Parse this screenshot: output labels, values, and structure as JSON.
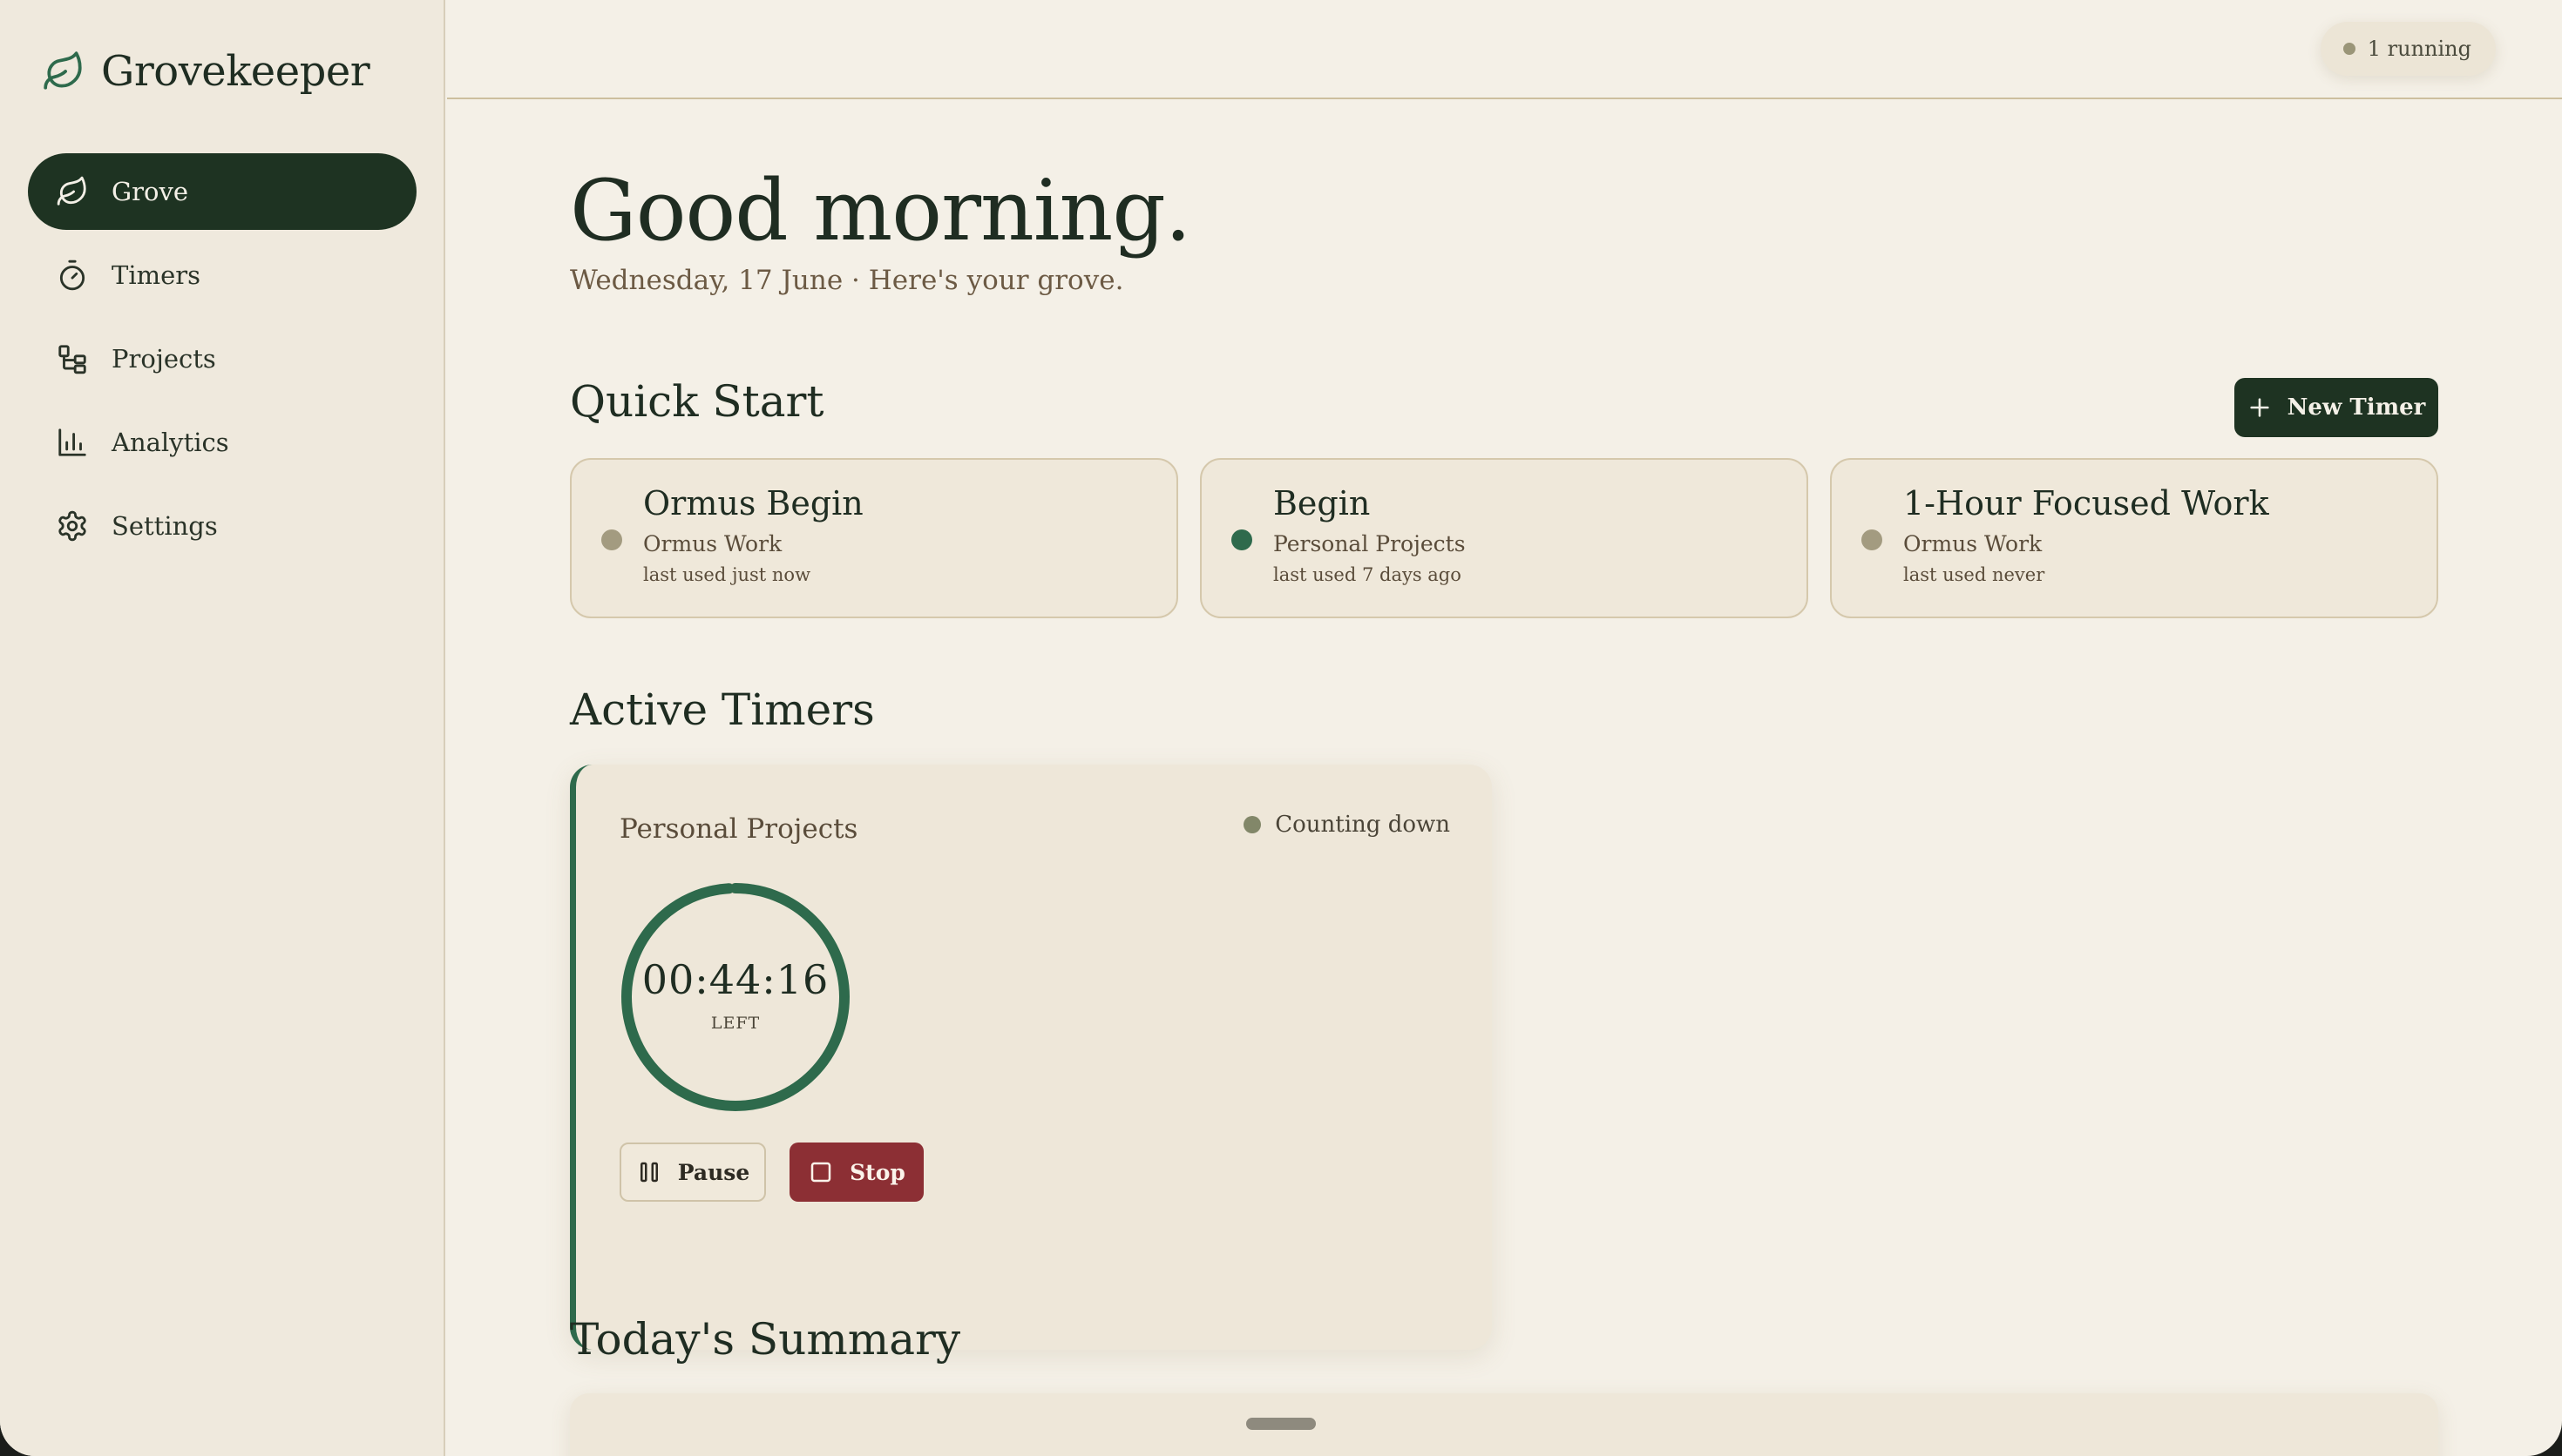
{
  "app": {
    "name": "Grovekeeper"
  },
  "sidebar": {
    "items": [
      {
        "label": "Grove",
        "icon": "leaf-icon",
        "active": true
      },
      {
        "label": "Timers",
        "icon": "stopwatch-icon",
        "active": false
      },
      {
        "label": "Projects",
        "icon": "folder-tree-icon",
        "active": false
      },
      {
        "label": "Analytics",
        "icon": "bar-chart-icon",
        "active": false
      },
      {
        "label": "Settings",
        "icon": "gear-icon",
        "active": false
      }
    ]
  },
  "topbar": {
    "running_label": "1 running"
  },
  "main": {
    "greeting": "Good morning.",
    "date_line": "Wednesday, 17 June · Here's your grove.",
    "quick_start": {
      "title": "Quick Start",
      "new_timer_label": "New Timer",
      "cards": [
        {
          "name": "Ormus Begin",
          "project": "Ormus Work",
          "last_used": "last used just now",
          "color": "#a39b80"
        },
        {
          "name": "Begin",
          "project": "Personal Projects",
          "last_used": "last used 7 days ago",
          "color": "#2e6a4c"
        },
        {
          "name": "1-Hour Focused Work",
          "project": "Ormus Work",
          "last_used": "last used never",
          "color": "#a39b80"
        }
      ]
    },
    "active_timers": {
      "title": "Active Timers",
      "timers": [
        {
          "project": "Personal Projects",
          "status": "Counting down",
          "time": "00:44:16",
          "time_label": "LEFT",
          "progress_remaining": 0.99,
          "pause_label": "Pause",
          "stop_label": "Stop"
        }
      ]
    },
    "summary": {
      "title": "Today's Summary"
    }
  },
  "colors": {
    "accent_dark": "#1e3322",
    "accent_green": "#2e6a4c",
    "stop_red": "#8c2f34",
    "background": "#f4f0e7",
    "sidebar": "#efe9dd"
  }
}
